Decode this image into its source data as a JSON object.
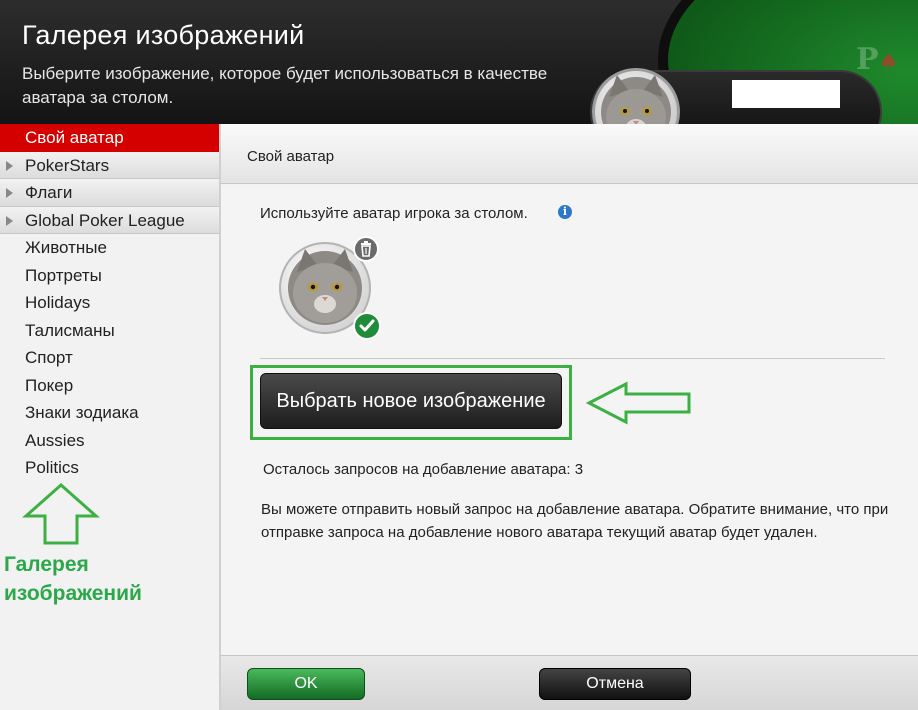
{
  "header": {
    "title": "Галерея изображений",
    "subtitle": "Выберите изображение, которое будет использоваться в качестве аватара за столом.",
    "logo_text": "P",
    "player": {
      "stack": "- -"
    }
  },
  "sidebar": {
    "items": [
      {
        "label": "Свой аватар",
        "selected": true,
        "expandable": false
      },
      {
        "label": "PokerStars",
        "expandable": true
      },
      {
        "label": "Флаги",
        "expandable": true
      },
      {
        "label": "Global Poker League",
        "expandable": true
      },
      {
        "label": "Животные"
      },
      {
        "label": "Портреты"
      },
      {
        "label": "Holidays"
      },
      {
        "label": "Талисманы"
      },
      {
        "label": "Спорт"
      },
      {
        "label": "Покер"
      },
      {
        "label": "Знаки зодиака"
      },
      {
        "label": "Aussies"
      },
      {
        "label": "Politics"
      }
    ],
    "annotation": {
      "line1": "Галерея",
      "line2": "изображений"
    }
  },
  "main": {
    "section_title": "Свой аватар",
    "use_text": "Используйте аватар игрока за столом.",
    "info_icon_glyph": "i",
    "choose_button": "Выбрать новое изображение",
    "requests_text": "Осталось запросов на добавление аватара: 3",
    "note": "Вы можете отправить новый запрос на добавление аватара. Обратите внимание, что при отправке запроса на добавление нового аватара текущий аватар будет удален."
  },
  "footer": {
    "ok_label": "OK",
    "cancel_label": "Отмена"
  },
  "colors": {
    "accent_red": "#d40000",
    "annotation_green": "#3cb043",
    "ok_green": "#1f8c3a"
  }
}
